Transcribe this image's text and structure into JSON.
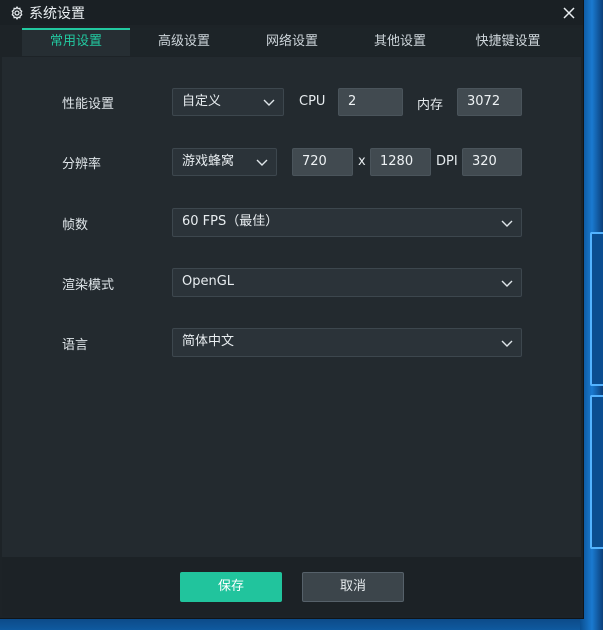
{
  "window": {
    "title": "系统设置"
  },
  "tabs": [
    "常用设置",
    "高级设置",
    "网络设置",
    "其他设置",
    "快捷键设置"
  ],
  "performance": {
    "label": "性能设置",
    "mode": "自定义",
    "cpu_label": "CPU",
    "cpu": "2",
    "memory_label": "内存",
    "memory": "3072"
  },
  "resolution": {
    "label": "分辨率",
    "preset": "游戏蜂窝",
    "width": "720",
    "times": "x",
    "height": "1280",
    "dpi_label": "DPI",
    "dpi": "320"
  },
  "fps": {
    "label": "帧数",
    "value": "60 FPS（最佳）"
  },
  "render": {
    "label": "渲染模式",
    "value": "OpenGL"
  },
  "language": {
    "label": "语言",
    "value": "简体中文"
  },
  "buttons": {
    "save": "保存",
    "cancel": "取消"
  },
  "colors": {
    "accent": "#22c9a0",
    "save_button": "#21c49d"
  },
  "icons": {
    "title": "gear-icon",
    "close": "close-icon",
    "dropdown": "chevron-down-icon"
  }
}
